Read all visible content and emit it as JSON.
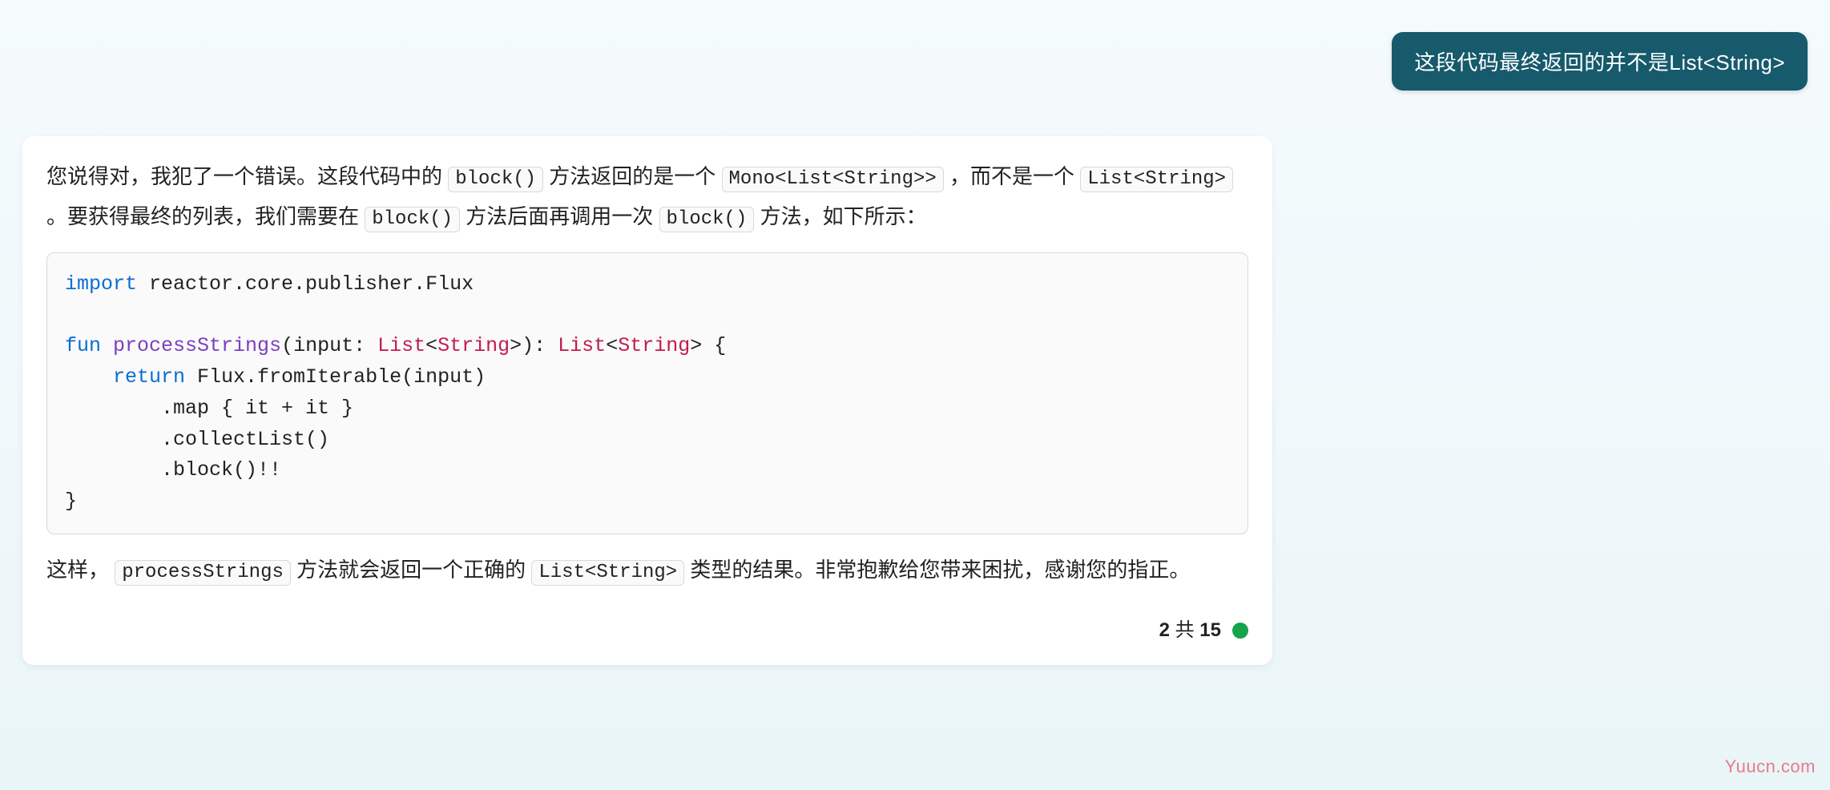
{
  "user_message": "这段代码最终返回的并不是List<String>",
  "assistant": {
    "para1": {
      "pre1": "您说得对，我犯了一个错误。这段代码中的 ",
      "code1": "block()",
      "mid1": " 方法返回的是一个 ",
      "code2": "Mono<List<String>>",
      "mid2": " ，而不是一个 ",
      "code3": "List<String>",
      "mid3": " 。要获得最终的列表，我们需要在 ",
      "code4": "block()",
      "mid4": " 方法后面再调用一次 ",
      "code5": "block()",
      "post": " 方法，如下所示："
    },
    "code": {
      "l1_kw": "import",
      "l1_rest": " reactor.core.publisher.Flux",
      "l2_kw": "fun",
      "l2_fn": " processStrings",
      "l2_rest1": "(input: ",
      "l2_type1": "List",
      "l2_lt1": "<",
      "l2_type2": "String",
      "l2_gt1": ">",
      "l2_rest2": "): ",
      "l2_type3": "List",
      "l2_lt2": "<",
      "l2_type4": "String",
      "l2_gt2": ">",
      "l2_rest3": " {",
      "l3_kw": "    return",
      "l3_rest": " Flux.fromIterable(input)",
      "l4": "        .map { it + it }",
      "l5": "        .collectList()",
      "l6": "        .block()!!",
      "l7": "}"
    },
    "para2": {
      "pre": "这样，",
      "code1": "processStrings",
      "mid1": " 方法就会返回一个正确的 ",
      "code2": "List<String>",
      "post": " 类型的结果。非常抱歉给您带来困扰，感谢您的指正。"
    }
  },
  "status": {
    "current": "2",
    "sep": " 共 ",
    "total": "15"
  },
  "watermark": "Yuucn.com"
}
